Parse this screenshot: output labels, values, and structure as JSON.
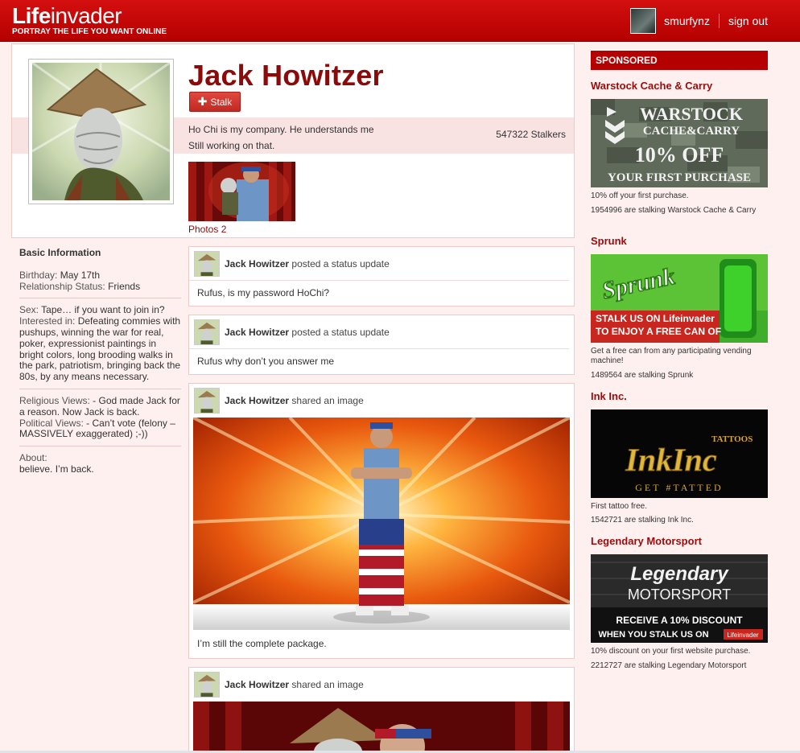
{
  "header": {
    "logo_bold": "Life",
    "logo_light": "invader",
    "tagline": "PORTRAY THE LIFE YOU WANT ONLINE",
    "username": "smurfynz",
    "signout": "sign out"
  },
  "profile": {
    "name": "Jack Howitzer",
    "stalk_button": "Stalk",
    "status_line1": "Ho Chi is my company. He understands me",
    "status_line2": "Still working on that.",
    "stalkers": "547322 Stalkers",
    "photos_link": "Photos 2"
  },
  "basic_info": {
    "heading": "Basic Information",
    "birthday_label": "Birthday:",
    "birthday": "May 17th",
    "relationship_label": "Relationship Status:",
    "relationship": "Friends",
    "sex_label": "Sex:",
    "sex": "Tape… if you want to join in?",
    "interested_label": "Interested in:",
    "interested": "Defeating commies with pushups, winning the war for real, poker, expressionist paintings in bright colors, long brooding walks in the park, patriotism, bringing back the 80s, by any means necessary.",
    "religious_label": "Religious Views:",
    "religious": "- God made Jack for a reason. Now Jack is back.",
    "political_label": "Political Views:",
    "political": "- Can’t vote (felony – MASSIVELY exaggerated) ;-))",
    "about_label": "About:",
    "about": "believe. I’m back."
  },
  "feed": [
    {
      "author": "Jack Howitzer",
      "action": "posted a status update",
      "text": "Rufus, is my password HoChi?"
    },
    {
      "author": "Jack Howitzer",
      "action": "posted a status update",
      "text": "Rufus why don’t you answer me"
    },
    {
      "author": "Jack Howitzer",
      "action": "shared an image",
      "text": "I’m still the complete package."
    },
    {
      "author": "Jack Howitzer",
      "action": "shared an image",
      "text": ""
    }
  ],
  "sponsored": {
    "title": "SPONSORED",
    "ads": [
      {
        "name": "Warstock Cache & Carry",
        "line1": "WARSTOCK",
        "line2": "CACHE&CARRY",
        "line3": "10% OFF",
        "line4": "YOUR FIRST PURCHASE",
        "desc": "10% off your first purchase.",
        "stalkers": "1954996 are stalking Warstock Cache & Carry"
      },
      {
        "name": "Sprunk",
        "logo": "Sprunk",
        "line1": "STALK US ON Lifeinvader",
        "line2": "TO ENJOY A FREE CAN OF",
        "desc": "Get a free can from any participating vending machine!",
        "stalkers": "1489564 are stalking Sprunk"
      },
      {
        "name": "Ink Inc.",
        "logo": "InkInc",
        "sub": "TATTOOS",
        "tag": "GET #TATTED",
        "desc": "First tattoo free.",
        "stalkers": "1542721 are stalking Ink Inc."
      },
      {
        "name": "Legendary Motorsport",
        "logo1": "Legendary",
        "logo2": "MOTORSPORT",
        "line1": "RECEIVE A 10% DISCOUNT",
        "line2": "WHEN YOU STALK US ON",
        "badge": "Lifeinvader",
        "desc": "10% discount on your first website purchase.",
        "stalkers": "2212727 are stalking Legendary Motorsport"
      }
    ]
  },
  "colors": {
    "brand_red": "#c30000",
    "name_red": "#8b0a0a",
    "page_bg": "#fdf0ef"
  }
}
